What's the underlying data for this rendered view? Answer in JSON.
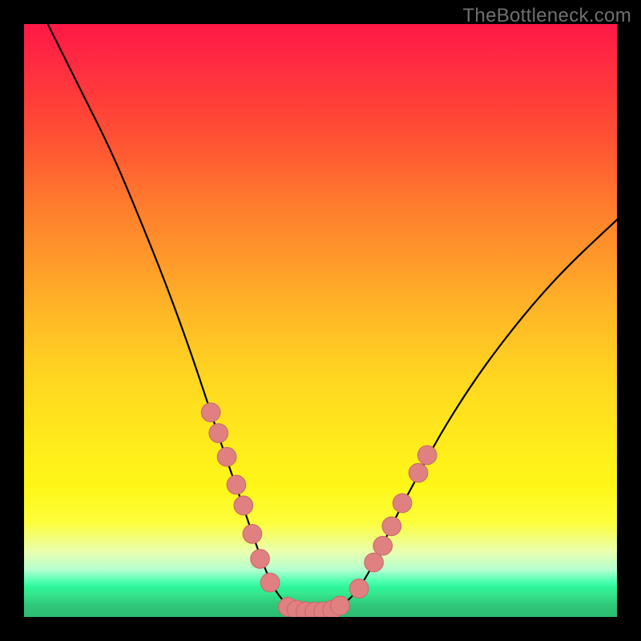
{
  "watermark": "TheBottleneck.com",
  "colors": {
    "frame": "#000000",
    "curve": "#000000",
    "marker_fill": "#e08080",
    "marker_stroke": "#c86868"
  },
  "chart_data": {
    "type": "line",
    "title": "",
    "xlabel": "",
    "ylabel": "",
    "xlim": [
      0,
      100
    ],
    "ylim": [
      0,
      100
    ],
    "curve": {
      "x": [
        4,
        10,
        15,
        20,
        24,
        28,
        31,
        34,
        36.5,
        38.5,
        40.5,
        42,
        44,
        46,
        48,
        50,
        52,
        54.5,
        57,
        59.5,
        62.5,
        66,
        70,
        75,
        80,
        86,
        92,
        100
      ],
      "y": [
        100,
        88,
        78,
        66,
        56,
        45,
        36,
        27,
        20,
        14,
        8.5,
        5,
        2.3,
        1.2,
        0.9,
        0.9,
        1.2,
        2.5,
        5.5,
        10,
        16.5,
        23,
        30.5,
        38.5,
        45.5,
        53,
        59.5,
        67
      ]
    },
    "markers_left": {
      "x": [
        31.5,
        32.8,
        34.2,
        35.8,
        37.0,
        38.5,
        39.8,
        41.5
      ],
      "y": [
        34.5,
        31.0,
        27.0,
        22.3,
        18.8,
        14.0,
        9.8,
        5.8
      ]
    },
    "markers_bottom": {
      "x": [
        44.5,
        46.0,
        47.5,
        49.0,
        50.5,
        52.0,
        53.3
      ],
      "y": [
        1.7,
        1.2,
        0.95,
        0.9,
        0.95,
        1.2,
        1.9
      ]
    },
    "markers_right": {
      "x": [
        56.5,
        59.0,
        60.5,
        62.0,
        63.8,
        66.5,
        68.0
      ],
      "y": [
        4.8,
        9.2,
        12.0,
        15.3,
        19.2,
        24.3,
        27.3
      ]
    },
    "marker_radius": 1.6
  }
}
